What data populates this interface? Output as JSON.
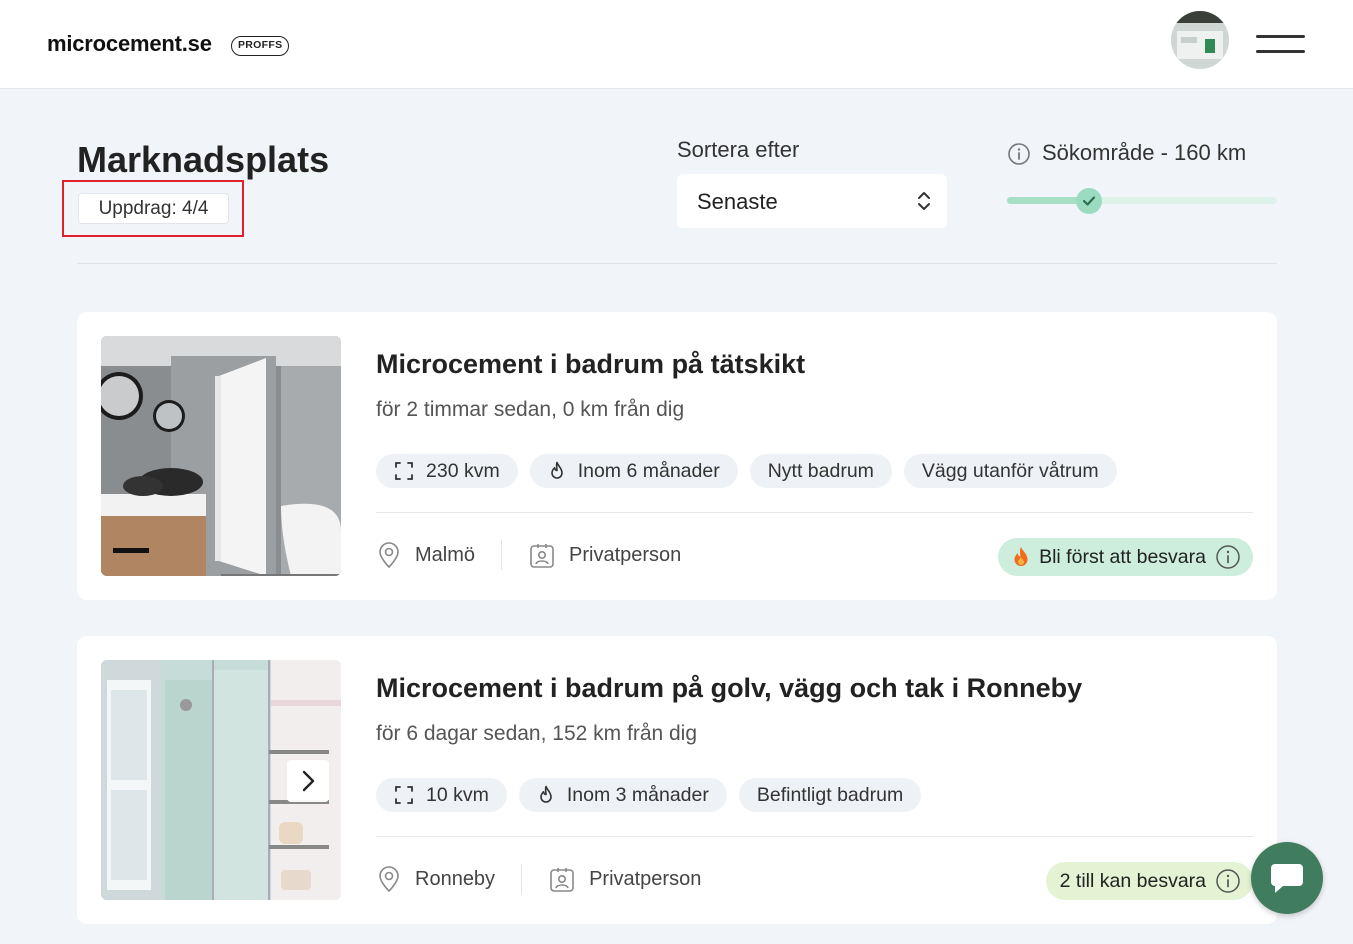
{
  "header": {
    "logo": "microcement.se",
    "logo_badge": "PROFFS"
  },
  "page": {
    "title": "Marknadsplats",
    "count_badge": "Uppdrag: 4/4"
  },
  "sort": {
    "label": "Sortera efter",
    "value": "Senaste"
  },
  "range": {
    "label": "Sökområde - 160 km",
    "value_km": 160,
    "fill_fraction": 0.3
  },
  "colors": {
    "accent_green": "#3f7d5e",
    "status_green": "#cdeedd",
    "status_lime": "#e3f3d3",
    "highlight_red": "#e0202a"
  },
  "listings": [
    {
      "title": "Microcement i badrum på tätskikt",
      "subtitle": "för 2 timmar sedan, 0 km från dig",
      "tags": [
        {
          "icon": "expand-icon",
          "label": "230 kvm"
        },
        {
          "icon": "fire-icon",
          "label": "Inom 6 månader"
        },
        {
          "icon": "",
          "label": "Nytt badrum"
        },
        {
          "icon": "",
          "label": "Vägg utanför våtrum"
        }
      ],
      "location": "Malmö",
      "customer_type": "Privatperson",
      "status": "Bli först att besvara",
      "status_icon": "flame-icon"
    },
    {
      "title": "Microcement i badrum på golv, vägg och tak i Ronneby",
      "subtitle": "för 6 dagar sedan, 152 km från dig",
      "tags": [
        {
          "icon": "expand-icon",
          "label": "10 kvm"
        },
        {
          "icon": "fire-icon",
          "label": "Inom 3 månader"
        },
        {
          "icon": "",
          "label": "Befintligt badrum"
        }
      ],
      "location": "Ronneby",
      "customer_type": "Privatperson",
      "status": "2 till kan besvara",
      "status_icon": ""
    }
  ]
}
